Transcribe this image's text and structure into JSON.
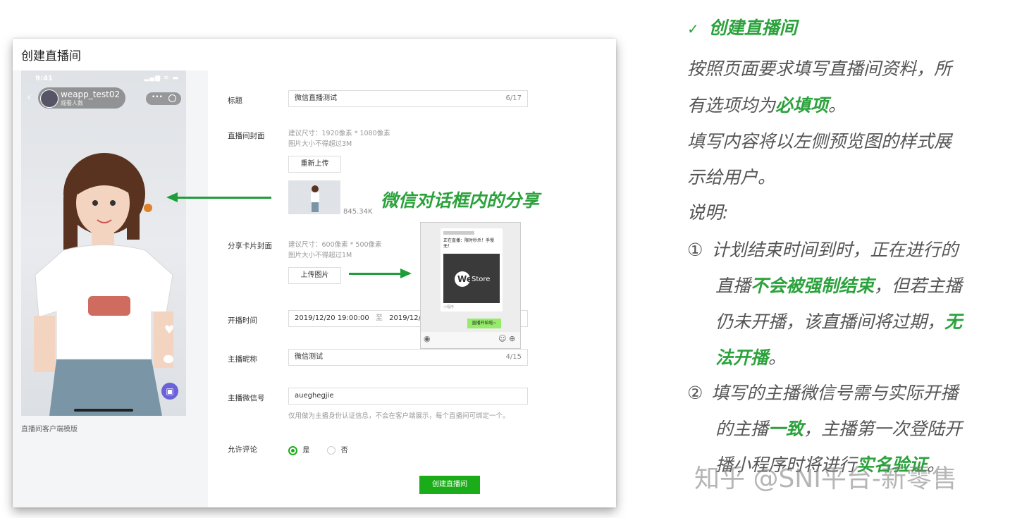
{
  "card": {
    "title": "创建直播间"
  },
  "phone": {
    "time": "9:41",
    "status_icons": "▂▄▆ ≋ ▬",
    "room_name": "weapp_test02",
    "viewers": "观看人数",
    "capsule_dots": "•••",
    "caption": "直播间客户端模版"
  },
  "form": {
    "title": {
      "label": "标题",
      "value": "微信直播测试",
      "count": "6/17"
    },
    "cover": {
      "label": "直播间封面",
      "hint1": "建议尺寸：1920像素 * 1080像素",
      "hint2": "图片大小不得超过3M",
      "button": "重新上传",
      "size": "845.34K"
    },
    "share_cover": {
      "label": "分享卡片封面",
      "hint1": "建议尺寸：600像素 * 500像素",
      "hint2": "图片大小不得超过1M",
      "button": "上传图片"
    },
    "start_time": {
      "label": "开播时间",
      "start": "2019/12/20 19:00:00",
      "to": "至",
      "end": "2019/12/2"
    },
    "anchor_name": {
      "label": "主播昵称",
      "value": "微信测试",
      "count": "4/15"
    },
    "anchor_wechat": {
      "label": "主播微信号",
      "value": "aueghegjie",
      "hint": "仅用做为主播身份认证信息，不会在客户端展示，每个直播间可绑定一个。"
    },
    "comments": {
      "label": "允许评论",
      "yes": "是",
      "no": "否"
    },
    "submit": "创建直播间"
  },
  "chat": {
    "card_title": "正在直播：限时秒杀！手慢无！",
    "we": "We",
    "store": "Store",
    "mini_label": "小程序",
    "green_msg": "直播开始啦~"
  },
  "annotation": "微信对话框内的分享",
  "right_panel": {
    "heading": "创建直播间",
    "l1": "按照页面要求填写直播间资料，所",
    "l2a": "有选项均为",
    "l2b": "必填项",
    "l2c": "。",
    "l3": "填写内容将以左侧预览图的样式展",
    "l4": "示给用户。",
    "l5": "说明:",
    "n1": "①",
    "l6": "计划结束时间到时，正在进行的",
    "l7a": "直播",
    "l7b": "不会被强制结束",
    "l7c": "，但若主播",
    "l8a": "仍未开播，该直播间将过期，",
    "l8b": "无",
    "l9a": "法开播",
    "l9b": "。",
    "n2": "②",
    "l10": "填写的主播微信号需与实际开播",
    "l11a": "的主播",
    "l11b": "一致",
    "l11c": "，主播第一次登陆开",
    "l12a": "播小程序时将进行",
    "l12b": "实名验证",
    "l12c": "。"
  },
  "watermark": "知乎 @SNI平台-新零售",
  "colors": {
    "accent_green": "#2ba23c",
    "button_green": "#1aad19"
  }
}
